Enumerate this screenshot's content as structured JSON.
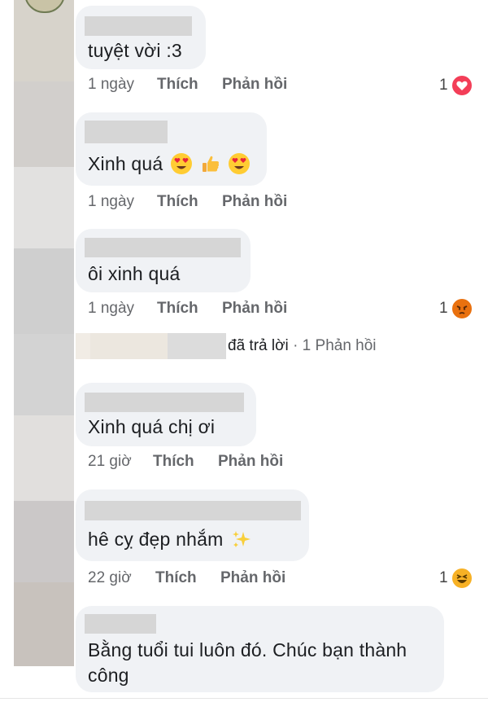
{
  "comments": [
    {
      "text": "tuyệt vời :3",
      "time": "1 ngày",
      "like": "Thích",
      "reply": "Phản hồi",
      "reaction_count": "1",
      "reaction": "heart"
    },
    {
      "text": "Xinh quá",
      "emojis": [
        "heart-eyes",
        "thumbs-up",
        "heart-eyes"
      ],
      "time": "1 ngày",
      "like": "Thích",
      "reply": "Phản hồi"
    },
    {
      "text": "ôi xinh quá",
      "time": "1 ngày",
      "like": "Thích",
      "reply": "Phản hồi",
      "reaction_count": "1",
      "reaction": "angry"
    },
    {
      "text": "Xinh quá chị ơi",
      "time": "21 giờ",
      "like": "Thích",
      "reply": "Phản hồi"
    },
    {
      "text": "hê cỵ đẹp nhắm",
      "emojis": [
        "sparkles"
      ],
      "time": "22 giờ",
      "like": "Thích",
      "reply": "Phản hồi",
      "reaction_count": "1",
      "reaction": "haha"
    },
    {
      "text_line1": "Bằng tuổi tui luôn đó. Chúc bạn thành",
      "text_line2": "công"
    }
  ],
  "reply_summary": {
    "replied_text": "đã trả lời",
    "separator": "·",
    "replies_text": "1 Phản hồi"
  },
  "colors": {
    "bubble": "#f0f2f5",
    "meta_text": "#65676b",
    "heart": "#f33e58",
    "angry": "#e9710f",
    "haha": "#f7b125"
  }
}
